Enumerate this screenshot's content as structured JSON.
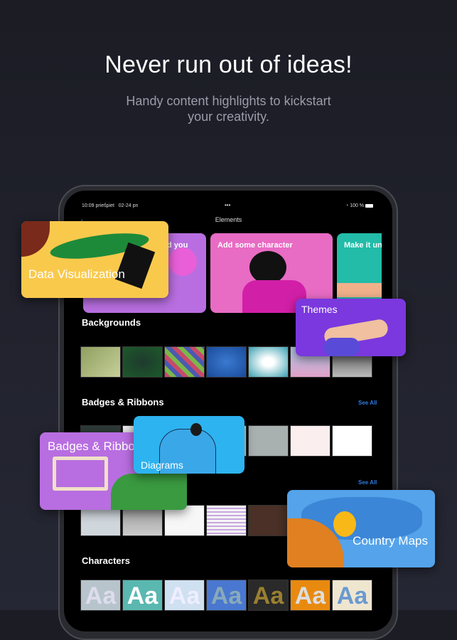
{
  "headline": "Never run out of ideas!",
  "subtitle_line1": "Handy content highlights to kickstart",
  "subtitle_line2": "your creativity.",
  "status": {
    "time": "10:09 priešpiet",
    "date": "02-24 pn",
    "battery": "100 %",
    "dots": "•••"
  },
  "nav": {
    "title": "Elements",
    "back": "‹"
  },
  "heroes": [
    {
      "label": "d you",
      "color": "#b86ee0"
    },
    {
      "label": "Add some character",
      "color": "#e86bc4"
    },
    {
      "label": "Make it uni",
      "color": "#22bca8"
    }
  ],
  "sections": {
    "backgrounds": "Backgrounds",
    "badges": "Badges & Ribbons",
    "characters": "Characters",
    "see_all": "See All"
  },
  "characters_glyph": "Aa",
  "overlays": {
    "data_viz": "Data Visualization",
    "themes": "Themes",
    "badges": "Badges & Ribbons",
    "diagrams": "Diagrams",
    "country_maps": "Country Maps"
  },
  "colors": {
    "accent": "#2d7be0",
    "data_viz": "#f9c94c",
    "themes": "#7a38de",
    "badges": "#b86ee0",
    "diagrams": "#2db3f0",
    "maps": "#55a3ea"
  }
}
